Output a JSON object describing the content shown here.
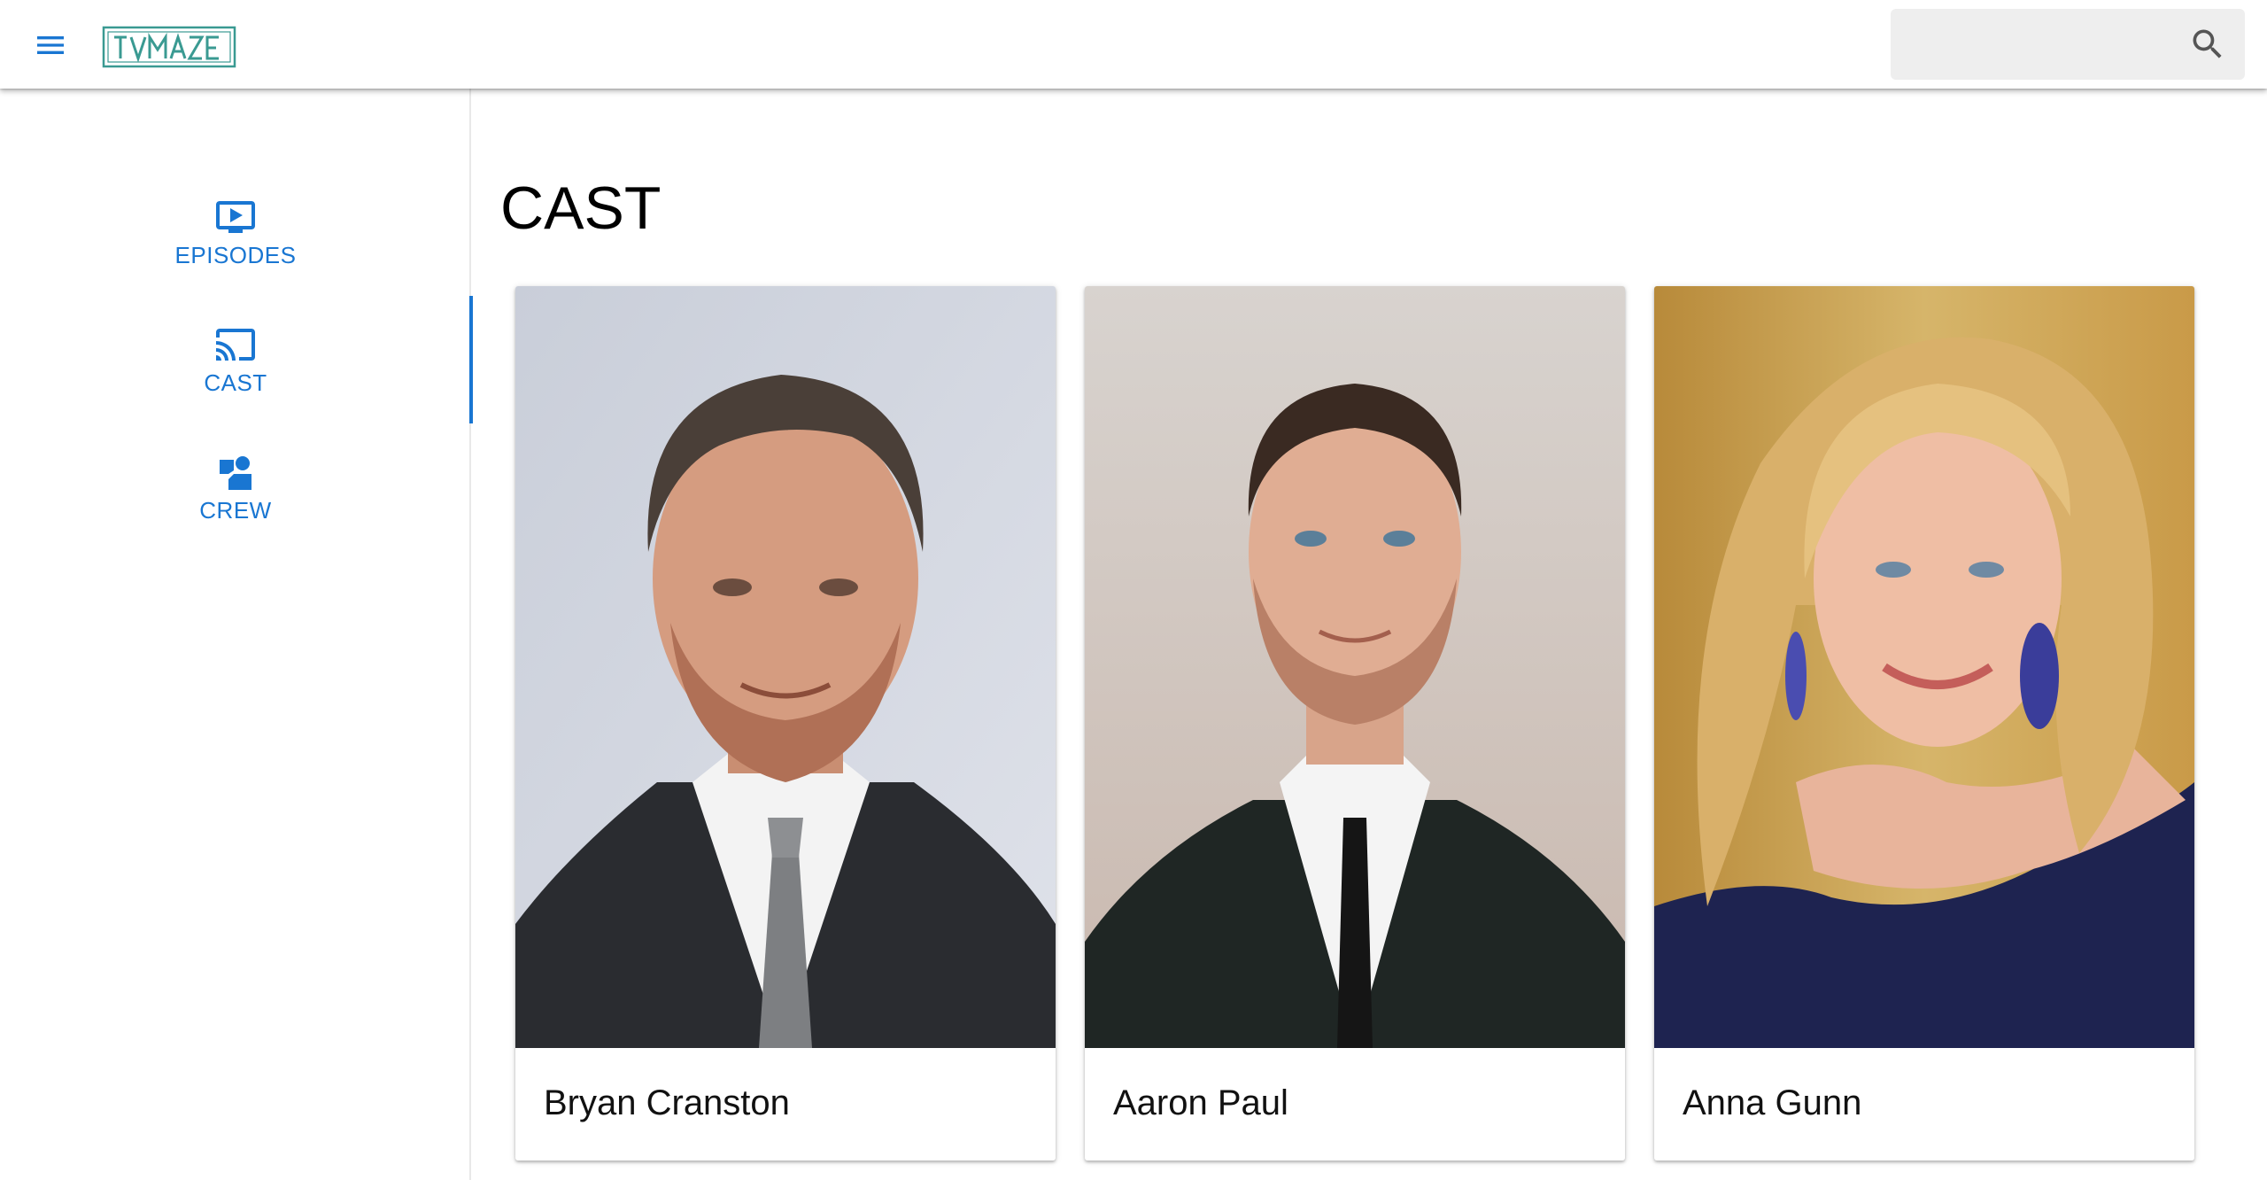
{
  "header": {
    "logo_text": "TVMAZE",
    "search": {
      "placeholder": "",
      "value": ""
    }
  },
  "sidebar": {
    "items": [
      {
        "label": "EPISODES",
        "icon": "tv-play-icon",
        "active": false
      },
      {
        "label": "CAST",
        "icon": "cast-icon",
        "active": true
      },
      {
        "label": "CREW",
        "icon": "crew-icon",
        "active": false
      }
    ]
  },
  "main": {
    "title": "CAST",
    "cast": [
      {
        "name": "Bryan Cranston"
      },
      {
        "name": "Aaron Paul"
      },
      {
        "name": "Anna Gunn"
      }
    ]
  },
  "colors": {
    "accent": "#1976d2",
    "logo": "#3a9a92",
    "search_bg": "#eeeeee"
  }
}
